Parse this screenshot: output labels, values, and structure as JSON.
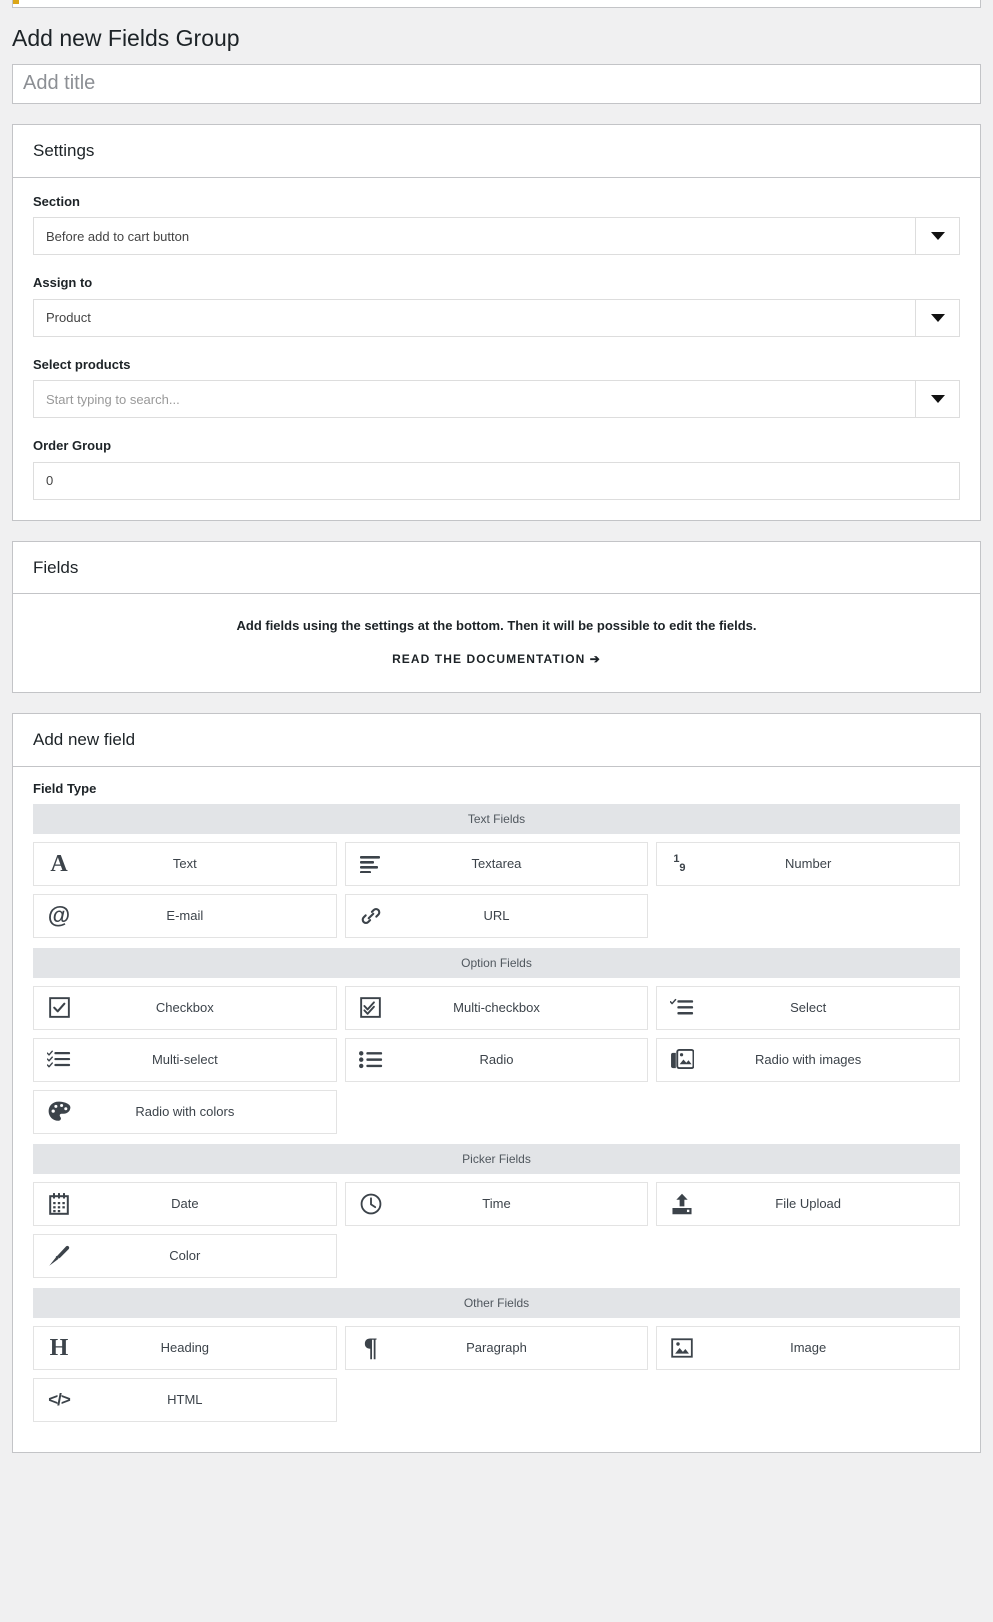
{
  "page": {
    "title": "Add new Fields Group",
    "title_input_placeholder": "Add title",
    "title_input_value": ""
  },
  "settings": {
    "heading": "Settings",
    "fields": [
      {
        "label": "Section",
        "control": "select",
        "value": "Before add to cart button",
        "placeholder": ""
      },
      {
        "label": "Assign to",
        "control": "select",
        "value": "Product",
        "placeholder": ""
      },
      {
        "label": "Select products",
        "control": "select",
        "value": "",
        "placeholder": "Start typing to search..."
      },
      {
        "label": "Order Group",
        "control": "text",
        "value": "0",
        "placeholder": ""
      }
    ]
  },
  "fields_panel": {
    "heading": "Fields",
    "empty_message": "Add fields using the settings at the bottom. Then it will be possible to edit the fields.",
    "doc_link_label": "READ THE DOCUMENTATION",
    "doc_link_arrow": "➔"
  },
  "add_field": {
    "heading": "Add new field",
    "field_type_label": "Field Type",
    "groups": [
      {
        "title": "Text Fields",
        "items": [
          {
            "label": "Text",
            "icon": "letter-a-icon"
          },
          {
            "label": "Textarea",
            "icon": "text-lines-icon"
          },
          {
            "label": "Number",
            "icon": "number-icon"
          },
          {
            "label": "E-mail",
            "icon": "at-sign-icon"
          },
          {
            "label": "URL",
            "icon": "link-chain-icon"
          }
        ]
      },
      {
        "title": "Option Fields",
        "items": [
          {
            "label": "Checkbox",
            "icon": "checkbox-icon"
          },
          {
            "label": "Multi-checkbox",
            "icon": "multi-checkbox-icon"
          },
          {
            "label": "Select",
            "icon": "select-list-icon"
          },
          {
            "label": "Multi-select",
            "icon": "multi-select-list-icon"
          },
          {
            "label": "Radio",
            "icon": "bullet-list-icon"
          },
          {
            "label": "Radio with images",
            "icon": "images-stack-icon"
          },
          {
            "label": "Radio with colors",
            "icon": "palette-icon"
          }
        ]
      },
      {
        "title": "Picker Fields",
        "items": [
          {
            "label": "Date",
            "icon": "calendar-icon"
          },
          {
            "label": "Time",
            "icon": "clock-icon"
          },
          {
            "label": "File Upload",
            "icon": "upload-icon"
          },
          {
            "label": "Color",
            "icon": "paintbrush-icon"
          }
        ]
      },
      {
        "title": "Other Fields",
        "items": [
          {
            "label": "Heading",
            "icon": "letter-h-icon"
          },
          {
            "label": "Paragraph",
            "icon": "pilcrow-icon"
          },
          {
            "label": "Image",
            "icon": "picture-icon"
          },
          {
            "label": "HTML",
            "icon": "code-brackets-icon"
          }
        ]
      }
    ]
  },
  "colors": {
    "page_background": "#f0f0f1",
    "panel_background": "#ffffff",
    "panel_border": "#c3c4c7",
    "group_header_background": "#e2e4e7",
    "accent_strip": "#dba617",
    "text": "#1d2327",
    "muted_text": "#8c8f94"
  }
}
